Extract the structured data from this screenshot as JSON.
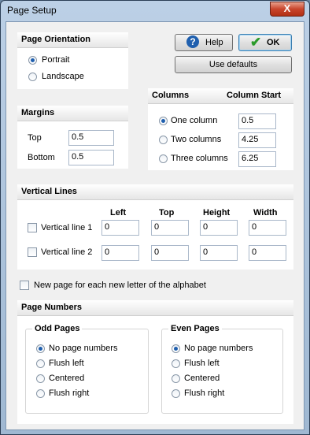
{
  "window": {
    "title": "Page Setup",
    "close_label": "X"
  },
  "orientation": {
    "heading": "Page Orientation",
    "options": [
      {
        "label": "Portrait",
        "selected": true
      },
      {
        "label": "Landscape",
        "selected": false
      }
    ]
  },
  "buttons": {
    "help": "Help",
    "ok": "OK",
    "use_defaults": "Use defaults"
  },
  "margins": {
    "heading": "Margins",
    "top_label": "Top",
    "top_value": "0.5",
    "bottom_label": "Bottom",
    "bottom_value": "0.5"
  },
  "columns": {
    "heading": "Columns",
    "start_heading": "Column Start",
    "options": [
      {
        "label": "One column",
        "selected": true,
        "start": "0.5"
      },
      {
        "label": "Two columns",
        "selected": false,
        "start": "4.25"
      },
      {
        "label": "Three columns",
        "selected": false,
        "start": "6.25"
      }
    ]
  },
  "vertical_lines": {
    "heading": "Vertical Lines",
    "col_headers": [
      "Left",
      "Top",
      "Height",
      "Width"
    ],
    "rows": [
      {
        "label": "Vertical line 1",
        "checked": false,
        "left": "0",
        "top": "0",
        "height": "0",
        "width": "0"
      },
      {
        "label": "Vertical line 2",
        "checked": false,
        "left": "0",
        "top": "0",
        "height": "0",
        "width": "0"
      }
    ]
  },
  "new_page": {
    "label": "New page for each new letter of the alphabet",
    "checked": false
  },
  "page_numbers": {
    "heading": "Page Numbers",
    "odd": {
      "heading": "Odd Pages",
      "options": [
        {
          "label": "No page numbers",
          "selected": true
        },
        {
          "label": "Flush left",
          "selected": false
        },
        {
          "label": "Centered",
          "selected": false
        },
        {
          "label": "Flush right",
          "selected": false
        }
      ]
    },
    "even": {
      "heading": "Even Pages",
      "options": [
        {
          "label": "No page numbers",
          "selected": true
        },
        {
          "label": "Flush left",
          "selected": false
        },
        {
          "label": "Centered",
          "selected": false
        },
        {
          "label": "Flush right",
          "selected": false
        }
      ]
    }
  },
  "colors": {
    "accent": "#1f5fae",
    "titlebar": "#bcd0e6",
    "close": "#c8452c",
    "ok_check": "#2a9a2a"
  }
}
